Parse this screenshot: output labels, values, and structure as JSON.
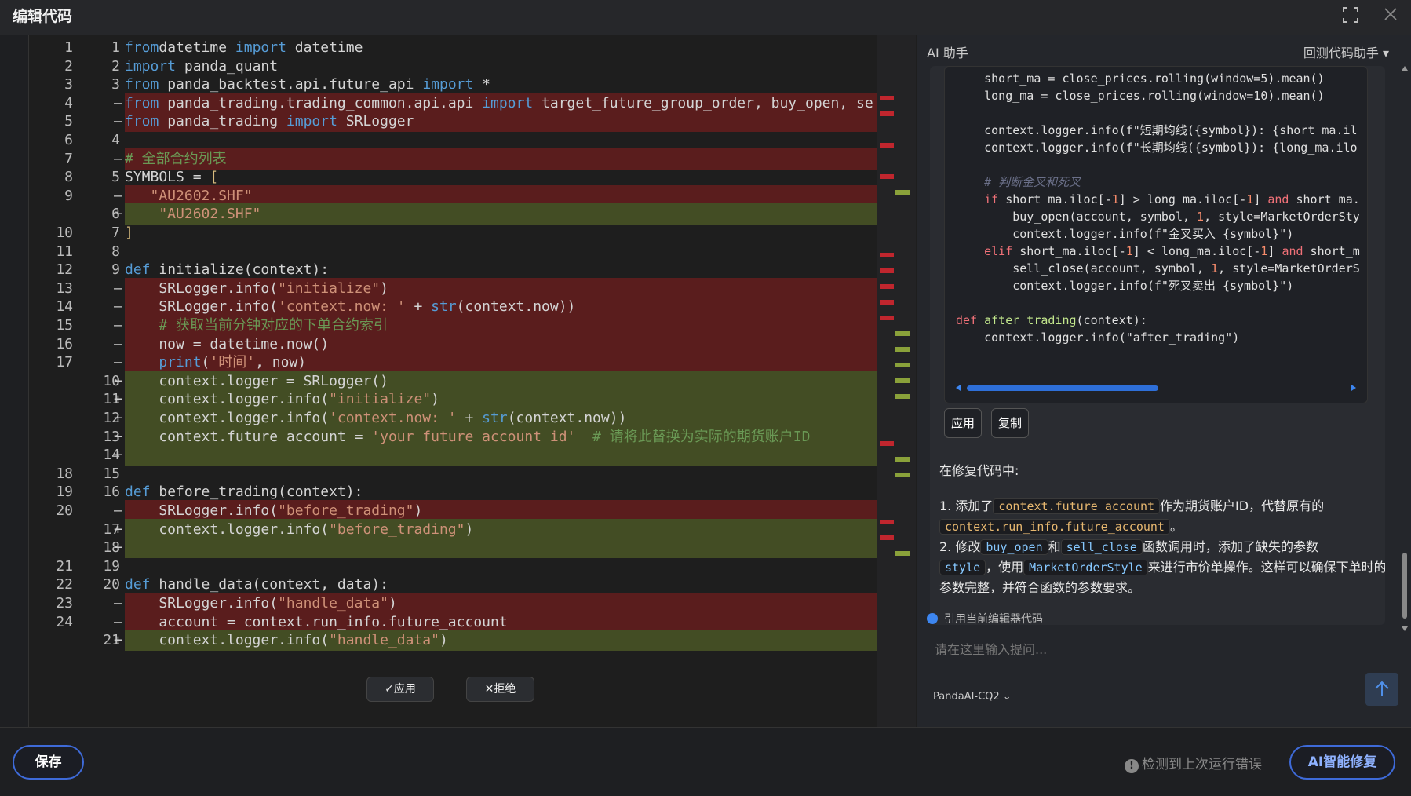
{
  "window": {
    "title": "编辑代码"
  },
  "editor": {
    "rows": [
      {
        "o": "1",
        "n": "1",
        "m": "",
        "t": "n",
        "code": [
          [
            "kw",
            "from"
          ],
          [
            "",
            "datetime "
          ],
          [
            "kw",
            "import"
          ],
          [
            "",
            " datetime"
          ]
        ]
      },
      {
        "o": "2",
        "n": "2",
        "m": "",
        "t": "n",
        "code": [
          [
            "kw",
            "import"
          ],
          [
            "",
            " panda_quant"
          ]
        ]
      },
      {
        "o": "3",
        "n": "3",
        "m": "",
        "t": "n",
        "code": [
          [
            "kw",
            "from"
          ],
          [
            "",
            " panda_backtest.api.future_api "
          ],
          [
            "kw",
            "import"
          ],
          [
            "",
            " *"
          ]
        ]
      },
      {
        "o": "4",
        "n": "",
        "m": "—",
        "t": "d",
        "code": [
          [
            "kw",
            "from"
          ],
          [
            "",
            " panda_trading.trading_common.api.api "
          ],
          [
            "kw",
            "import"
          ],
          [
            "",
            " target_future_group_order, buy_open, se"
          ]
        ]
      },
      {
        "o": "5",
        "n": "",
        "m": "—",
        "t": "d",
        "code": [
          [
            "kw",
            "from"
          ],
          [
            "",
            " panda_trading "
          ],
          [
            "kw",
            "import"
          ],
          [
            "",
            " SRLogger"
          ]
        ]
      },
      {
        "o": "6",
        "n": "4",
        "m": "",
        "t": "n",
        "code": []
      },
      {
        "o": "7",
        "n": "",
        "m": "—",
        "t": "d",
        "code": [
          [
            "cm",
            "# 全部合约列表"
          ]
        ]
      },
      {
        "o": "8",
        "n": "5",
        "m": "",
        "t": "n",
        "code": [
          [
            "",
            "SYMBOLS = "
          ],
          [
            "pu",
            "["
          ]
        ]
      },
      {
        "o": "9",
        "n": "",
        "m": "—",
        "t": "d",
        "code": [
          [
            "st",
            "   \"AU2602.SHF\""
          ]
        ]
      },
      {
        "o": "",
        "n": "6",
        "m": "+",
        "t": "a",
        "code": [
          [
            "st",
            "    \"AU2602.SHF\""
          ]
        ]
      },
      {
        "o": "10",
        "n": "7",
        "m": "",
        "t": "n",
        "code": [
          [
            "pu",
            "]"
          ]
        ]
      },
      {
        "o": "11",
        "n": "8",
        "m": "",
        "t": "n",
        "code": []
      },
      {
        "o": "12",
        "n": "9",
        "m": "",
        "t": "n",
        "code": [
          [
            "kw",
            "def"
          ],
          [
            "",
            " initialize(context):"
          ]
        ]
      },
      {
        "o": "13",
        "n": "",
        "m": "—",
        "t": "d",
        "code": [
          [
            "",
            "    SRLogger.info("
          ],
          [
            "st",
            "\"initialize\""
          ],
          [
            "",
            ")"
          ]
        ]
      },
      {
        "o": "14",
        "n": "",
        "m": "—",
        "t": "d",
        "code": [
          [
            "",
            "    SRLogger.info("
          ],
          [
            "st",
            "'context.now: '"
          ],
          [
            "",
            " + "
          ],
          [
            "kw",
            "str"
          ],
          [
            "",
            "(context.now))"
          ]
        ]
      },
      {
        "o": "15",
        "n": "",
        "m": "—",
        "t": "d",
        "code": [
          [
            "cm",
            "    # 获取当前分钟对应的下单合约索引"
          ]
        ]
      },
      {
        "o": "16",
        "n": "",
        "m": "—",
        "t": "d",
        "code": [
          [
            "",
            "    now = datetime.now()"
          ]
        ]
      },
      {
        "o": "17",
        "n": "",
        "m": "—",
        "t": "d",
        "code": [
          [
            "",
            "    "
          ],
          [
            "kw",
            "print"
          ],
          [
            "",
            "("
          ],
          [
            "st",
            "'时间'"
          ],
          [
            "",
            ", now)"
          ]
        ]
      },
      {
        "o": "",
        "n": "10",
        "m": "+",
        "t": "a",
        "code": [
          [
            "",
            "    context.logger = SRLogger()"
          ]
        ]
      },
      {
        "o": "",
        "n": "11",
        "m": "+",
        "t": "a",
        "code": [
          [
            "",
            "    context.logger.info("
          ],
          [
            "st",
            "\"initialize\""
          ],
          [
            "",
            ")"
          ]
        ]
      },
      {
        "o": "",
        "n": "12",
        "m": "+",
        "t": "a",
        "code": [
          [
            "",
            "    context.logger.info("
          ],
          [
            "st",
            "'context.now: '"
          ],
          [
            "",
            " + "
          ],
          [
            "kw",
            "str"
          ],
          [
            "",
            "(context.now))"
          ]
        ]
      },
      {
        "o": "",
        "n": "13",
        "m": "+",
        "t": "a",
        "code": [
          [
            "",
            "    context.future_account = "
          ],
          [
            "st",
            "'your_future_account_id'"
          ],
          [
            "",
            "  "
          ],
          [
            "cm",
            "# 请将此替换为实际的期货账户ID"
          ]
        ]
      },
      {
        "o": "",
        "n": "14",
        "m": "+",
        "t": "a",
        "code": []
      },
      {
        "o": "18",
        "n": "15",
        "m": "",
        "t": "n",
        "code": []
      },
      {
        "o": "19",
        "n": "16",
        "m": "",
        "t": "n",
        "code": [
          [
            "kw",
            "def"
          ],
          [
            "",
            " before_trading(context):"
          ]
        ]
      },
      {
        "o": "20",
        "n": "",
        "m": "—",
        "t": "d",
        "code": [
          [
            "",
            "    SRLogger.info("
          ],
          [
            "st",
            "\"before_trading\""
          ],
          [
            "",
            ")"
          ]
        ]
      },
      {
        "o": "",
        "n": "17",
        "m": "+",
        "t": "a",
        "code": [
          [
            "",
            "    context.logger.info("
          ],
          [
            "st",
            "\"before_trading\""
          ],
          [
            "",
            ")"
          ]
        ]
      },
      {
        "o": "",
        "n": "18",
        "m": "+",
        "t": "a",
        "code": []
      },
      {
        "o": "21",
        "n": "19",
        "m": "",
        "t": "n",
        "code": []
      },
      {
        "o": "22",
        "n": "20",
        "m": "",
        "t": "n",
        "code": [
          [
            "kw",
            "def"
          ],
          [
            "",
            " handle_data(context, data):"
          ]
        ]
      },
      {
        "o": "23",
        "n": "",
        "m": "—",
        "t": "d",
        "code": [
          [
            "",
            "    SRLogger.info("
          ],
          [
            "st",
            "\"handle_data\""
          ],
          [
            "",
            ")"
          ]
        ]
      },
      {
        "o": "24",
        "n": "",
        "m": "—",
        "t": "d",
        "code": [
          [
            "",
            "    account = context.run_info.future_account"
          ]
        ]
      },
      {
        "o": "",
        "n": "21",
        "m": "+",
        "t": "a",
        "code": [
          [
            "",
            "    context.logger.info("
          ],
          [
            "st",
            "\"handle_data\""
          ],
          [
            "",
            ")"
          ]
        ]
      }
    ],
    "accept_label": "✓应用",
    "reject_label": "✕拒绝"
  },
  "panel": {
    "title": "AI 助手",
    "mode": "回测代码助手 ▾",
    "code_lines": [
      [
        [
          "",
          "    short_ma = close_prices.rolling(window=5).mean()"
        ]
      ],
      [
        [
          "",
          "    long_ma = close_prices.rolling(window=10).mean()"
        ]
      ],
      [],
      [
        [
          "",
          "    context.logger.info(f\"短期均线({symbol}): {short_ma.il"
        ]
      ],
      [
        [
          "",
          "    context.logger.info(f\"长期均线({symbol}): {long_ma.ilo"
        ]
      ],
      [],
      [
        [
          "ccm",
          "    # 判断金叉和死叉"
        ]
      ],
      [
        [
          "ckw",
          "    if"
        ],
        [
          "",
          " short_ma.iloc[-"
        ],
        [
          "cnum",
          "1"
        ],
        [
          "",
          "] > long_ma.iloc[-"
        ],
        [
          "cnum",
          "1"
        ],
        [
          "",
          "] "
        ],
        [
          "ckw",
          "and"
        ],
        [
          "",
          " short_ma."
        ]
      ],
      [
        [
          "",
          "        buy_open(account, symbol, "
        ],
        [
          "cnum",
          "1"
        ],
        [
          "",
          ", style=MarketOrderSty"
        ]
      ],
      [
        [
          "",
          "        context.logger.info(f\"金叉买入 {symbol}\")"
        ]
      ],
      [
        [
          "ckw",
          "    elif"
        ],
        [
          "",
          " short_ma.iloc[-"
        ],
        [
          "cnum",
          "1"
        ],
        [
          "",
          "] < long_ma.iloc[-"
        ],
        [
          "cnum",
          "1"
        ],
        [
          "",
          "] "
        ],
        [
          "ckw",
          "and"
        ],
        [
          "",
          " short_m"
        ]
      ],
      [
        [
          "",
          "        sell_close(account, symbol, "
        ],
        [
          "cnum",
          "1"
        ],
        [
          "",
          ", style=MarketOrderS"
        ]
      ],
      [
        [
          "",
          "        context.logger.info(f\"死叉卖出 {symbol}\")"
        ]
      ],
      [],
      [
        [
          "ckw",
          "def"
        ],
        [
          "",
          " "
        ],
        [
          "cfn",
          "after_trading"
        ],
        [
          "",
          "(context):"
        ]
      ],
      [
        [
          "",
          "    context.logger.info(\"after_trading\")"
        ]
      ]
    ],
    "apply_label": "应用",
    "copy_label": "复制",
    "fixing_title": "在修复代码中:",
    "item1_a": "1. 添加了",
    "item1_chip1": "context.future_account",
    "item1_b": "作为期货账户ID，代替原有的",
    "item1_chip2": "context.run_info.future_account",
    "item1_c": "。",
    "item2_a": "2. 修改",
    "item2_chip1": "buy_open",
    "item2_b": "和",
    "item2_chip2": "sell_close",
    "item2_c": "函数调用时，添加了缺失的参数",
    "item2_chip3": "style",
    "item2_d": "，使用",
    "item2_chip4": "MarketOrderStyle",
    "item2_e": "来进行市价单操作。这样可以确保下单时的参数完整，并符合函数的参数要求。",
    "cite_label": "引用当前编辑器代码",
    "ask_placeholder": "请在这里输入提问...",
    "model": "PandaAI-CQ2 ⌄"
  },
  "footer": {
    "save_label": "保存",
    "detect_label": "检测到上次运行错误",
    "aifix_label": "AI智能修复"
  },
  "colors": {
    "del": "#5a1d1d",
    "add": "#434d24",
    "accent": "#3e6ad8"
  }
}
